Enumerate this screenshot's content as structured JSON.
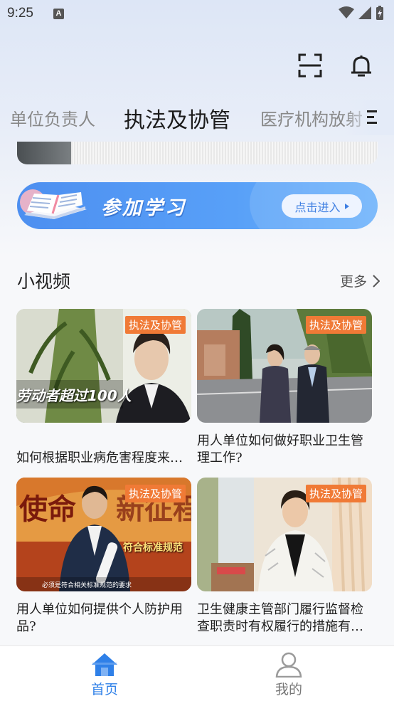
{
  "status_bar": {
    "time": "9:25",
    "notification_icon": "A"
  },
  "header": {
    "icons": [
      "scan-icon",
      "bell-icon"
    ]
  },
  "tabs": [
    {
      "label": "单位负责人",
      "active": false
    },
    {
      "label": "执法及协管",
      "active": true
    },
    {
      "label": "医疗机构放射",
      "active": false
    }
  ],
  "study_banner": {
    "title": "参加学习",
    "button_label": "点击进入"
  },
  "section": {
    "title": "小视频",
    "more_label": "更多"
  },
  "videos": [
    {
      "badge": "执法及协管",
      "title": "如何根据职业病危害程度来…",
      "overlay_text": "劳动者超过100人"
    },
    {
      "badge": "执法及协管",
      "title": "用人单位如何做好职业卫生管理工作?"
    },
    {
      "badge": "执法及协管",
      "title": "用人单位如何提供个人防护用品?",
      "overlay_text": "符合标准规范",
      "caption": "必须是符合相关标准规范的要求"
    },
    {
      "badge": "执法及协管",
      "title": "卫生健康主管部门履行监督检查职责时有权履行的措施有…"
    }
  ],
  "bottom_nav": [
    {
      "label": "首页",
      "icon": "home-icon",
      "active": true
    },
    {
      "label": "我的",
      "icon": "user-icon",
      "active": false
    }
  ],
  "colors": {
    "accent": "#2f80e8",
    "badge": "#f07a36",
    "banner": "#4d8ff0"
  }
}
